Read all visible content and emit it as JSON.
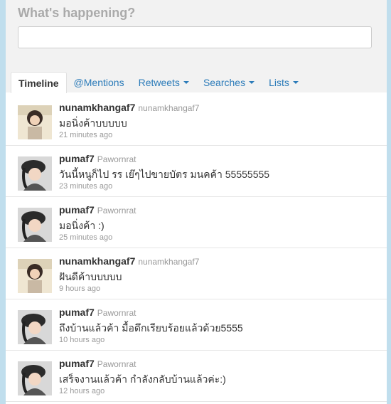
{
  "header": {
    "title": "What's happening?"
  },
  "tabs": [
    {
      "label": "Timeline",
      "dropdown": false
    },
    {
      "label": "@Mentions",
      "dropdown": false
    },
    {
      "label": "Retweets",
      "dropdown": true
    },
    {
      "label": "Searches",
      "dropdown": true
    },
    {
      "label": "Lists",
      "dropdown": true
    }
  ],
  "tweets": [
    {
      "username": "nunamkhangaf7",
      "realname": "nunamkhangaf7",
      "text": "มอนิ่งค้าบบบบบ",
      "time": "21 minutes ago",
      "avatar": "avatar-a"
    },
    {
      "username": "pumaf7",
      "realname": "Pawornrat",
      "text": "วันนี้หนูก็ไป รร เย๊ๆไปขายบัตร มนคค้า 55555555",
      "time": "23 minutes ago",
      "avatar": "avatar-b"
    },
    {
      "username": "pumaf7",
      "realname": "Pawornrat",
      "text": "มอนิ่งค้า :)",
      "time": "25 minutes ago",
      "avatar": "avatar-b"
    },
    {
      "username": "nunamkhangaf7",
      "realname": "nunamkhangaf7",
      "text": "ฝันดีค้าบบบบบ",
      "time": "9 hours ago",
      "avatar": "avatar-a"
    },
    {
      "username": "pumaf7",
      "realname": "Pawornrat",
      "text": "ถึงบ้านแล้วค้า มื้อดึกเรียบร้อยแล้วด้วย5555",
      "time": "10 hours ago",
      "avatar": "avatar-b"
    },
    {
      "username": "pumaf7",
      "realname": "Pawornrat",
      "text": "เสร็จงานแล้วค้า กำลังกลับบ้านแล้วค่ะ:)",
      "time": "12 hours ago",
      "avatar": "avatar-b"
    }
  ],
  "colors": {
    "accent": "#2b7bb9",
    "background": "#c0deed"
  }
}
